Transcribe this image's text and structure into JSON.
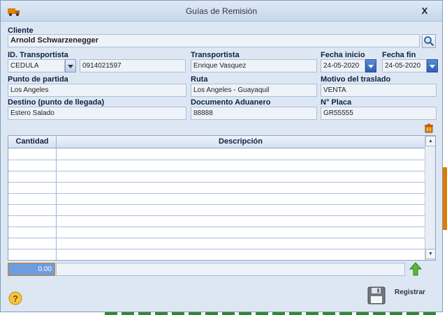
{
  "window": {
    "title": "Guías de Remisión",
    "close_label": "X"
  },
  "cliente": {
    "label": "Cliente",
    "value": "Arnold Schwarzenegger"
  },
  "id_transportista": {
    "label": "ID. Transportista",
    "tipo": "CEDULA",
    "numero": "0914021597"
  },
  "transportista": {
    "label": "Transportista",
    "value": "Enrique Vasquez"
  },
  "fecha_inicio": {
    "label": "Fecha inicio",
    "value": "24-05-2020"
  },
  "fecha_fin": {
    "label": "Fecha fin",
    "value": "24-05-2020"
  },
  "punto_partida": {
    "label": "Punto de partida",
    "value": "Los Angeles"
  },
  "ruta": {
    "label": "Ruta",
    "value": "Los Angeles - Guayaquil"
  },
  "motivo": {
    "label": "Motivo del traslado",
    "value": "VENTA"
  },
  "destino": {
    "label": "Destino (punto de llegada)",
    "value": "Estero Salado"
  },
  "documento_aduanero": {
    "label": "Documento Aduanero",
    "value": "88888"
  },
  "placa": {
    "label": "N° Placa",
    "value": "GR55555"
  },
  "table": {
    "columns": [
      "Cantidad",
      "Descripción"
    ],
    "rows": []
  },
  "total": {
    "value": "0.00"
  },
  "footer": {
    "register_label": "Registrar"
  },
  "icons": {
    "title": "truck-icon",
    "search": "magnifier-icon",
    "delete_row": "trash-icon",
    "add": "up-arrow-icon",
    "help": "help-icon",
    "save": "floppy-disk-icon"
  },
  "colors": {
    "accent": "#2c5fb5",
    "total_bg": "#6d9ce0",
    "total_border": "#e07b00"
  }
}
